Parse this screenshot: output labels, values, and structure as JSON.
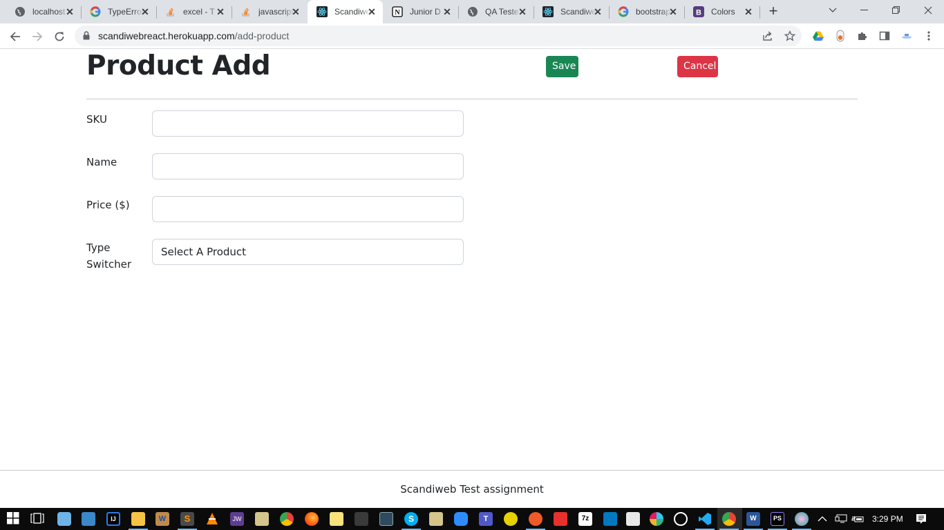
{
  "browser": {
    "tabs": [
      {
        "title": "localhost",
        "icon": "globe-icon",
        "active": false
      },
      {
        "title": "TypeError",
        "icon": "google-icon",
        "active": false
      },
      {
        "title": "excel - T",
        "icon": "stackoverflow-icon",
        "active": false
      },
      {
        "title": "javascript",
        "icon": "stackoverflow-icon",
        "active": false
      },
      {
        "title": "Scandiweb",
        "icon": "react-icon",
        "active": true
      },
      {
        "title": "Junior D",
        "icon": "notion-icon",
        "active": false
      },
      {
        "title": "QA Teste",
        "icon": "globe-icon",
        "active": false
      },
      {
        "title": "Scandiweb",
        "icon": "react-icon",
        "active": false
      },
      {
        "title": "bootstrap",
        "icon": "google-icon",
        "active": false
      },
      {
        "title": "Colors",
        "icon": "bootstrap-icon",
        "active": false
      }
    ],
    "url_host": "scandiwebreact.herokuapp.com",
    "url_path": "/add-product"
  },
  "page": {
    "title": "Product Add",
    "save_label": "Save",
    "cancel_label": "Cancel",
    "colors": {
      "save": "#198754",
      "cancel": "#dc3545"
    },
    "fields": [
      {
        "label": "SKU",
        "value": ""
      },
      {
        "label": "Name",
        "value": ""
      },
      {
        "label": "Price ($)",
        "value": ""
      }
    ],
    "type_switcher": {
      "label_line1": "Type",
      "label_line2": "Switcher",
      "selected": "Select A Product"
    },
    "footer": "Scandiweb Test assignment"
  },
  "taskbar": {
    "time": "3:29 PM"
  }
}
